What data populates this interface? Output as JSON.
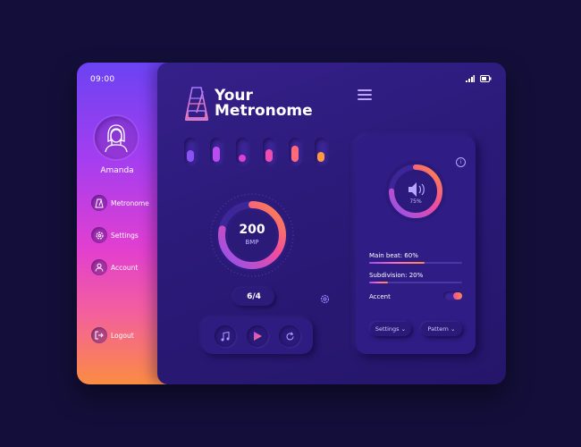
{
  "status": {
    "time": "09:00"
  },
  "user": {
    "name": "Amanda"
  },
  "sidebar": {
    "items": [
      {
        "label": "Metronome",
        "icon": "metronome-icon"
      },
      {
        "label": "Settings",
        "icon": "gear-icon"
      },
      {
        "label": "Account",
        "icon": "user-icon"
      }
    ],
    "logout_label": "Logout"
  },
  "app": {
    "title_line1": "Your",
    "title_line2": "Metronome"
  },
  "beat_sliders": [
    {
      "level": 0.55,
      "color": "#8a52f5"
    },
    {
      "level": 0.7,
      "color": "#b94ef0"
    },
    {
      "level": 0.3,
      "color": "#e040d0"
    },
    {
      "level": 0.6,
      "color": "#f24bb0"
    },
    {
      "level": 0.75,
      "color": "#ff6a7a"
    },
    {
      "level": 0.45,
      "color": "#ff9a40"
    }
  ],
  "tempo": {
    "value": "200",
    "unit": "BMP",
    "level": 0.78
  },
  "time_signature": "6/4",
  "volume": {
    "percent_label": "75%",
    "level": 0.75
  },
  "mix": {
    "main_beat_label": "Main beat: 60%",
    "main_beat_level": 0.6,
    "subdivision_label": "Subdivision: 20%",
    "subdivision_level": 0.2,
    "accent_label": "Accent",
    "accent_on": true
  },
  "card_buttons": {
    "settings_label": "Settings",
    "pattern_label": "Pattern"
  },
  "colors": {
    "background": "#130f3a",
    "panel": "#2a1a75",
    "accent_start": "#8a52f5",
    "accent_mid": "#f04ba0",
    "accent_end": "#ff8a40"
  }
}
